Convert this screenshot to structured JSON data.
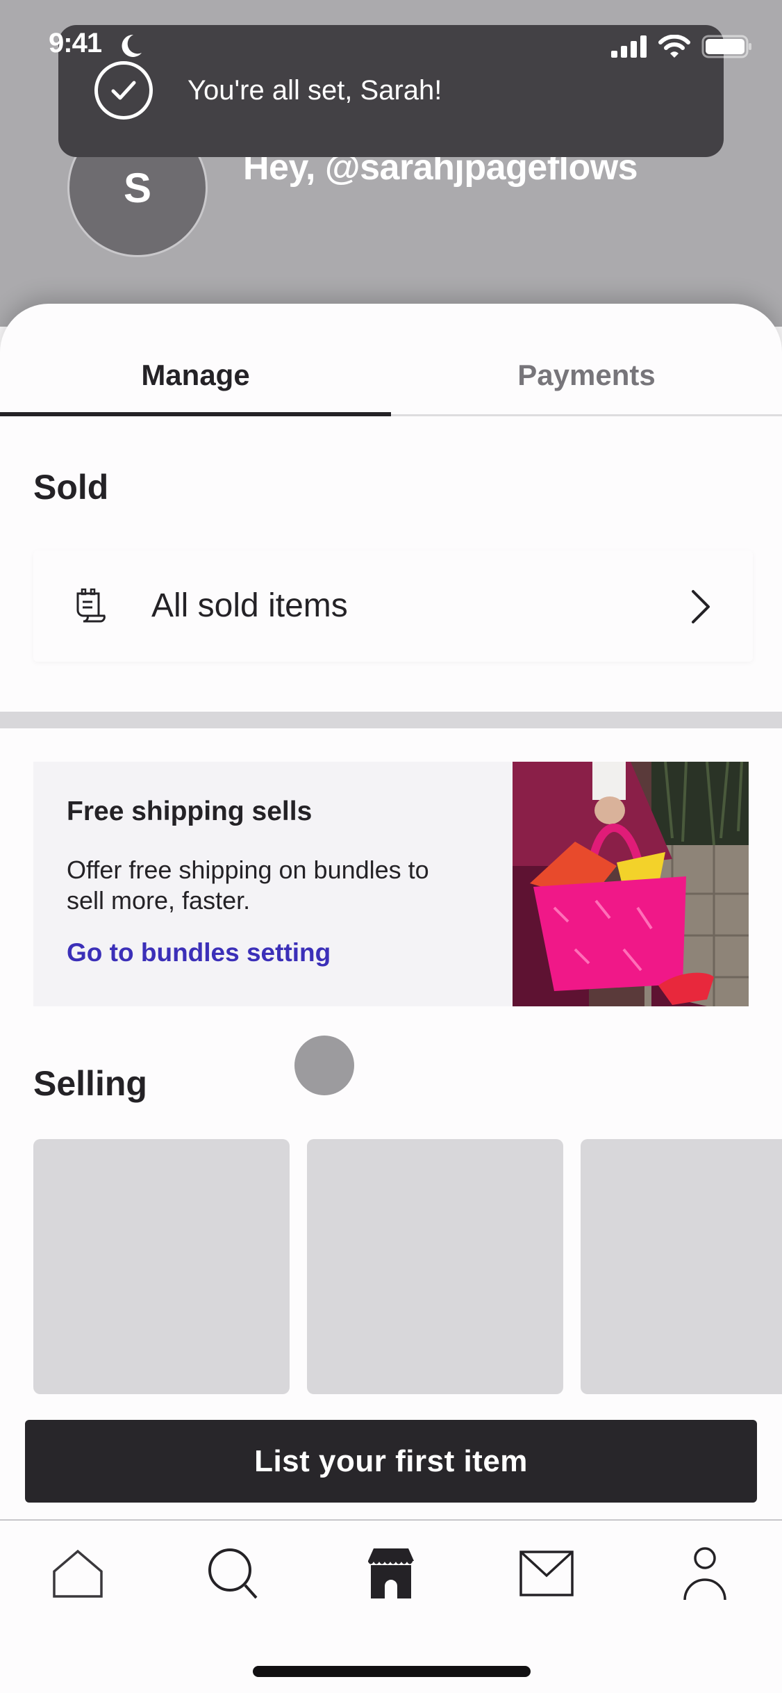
{
  "status_bar": {
    "time": "9:41",
    "icons": [
      "moon-icon",
      "cellular-signal-icon",
      "wifi-icon",
      "battery-icon"
    ]
  },
  "toast": {
    "icon": "check-circle-icon",
    "message": "You're all set, Sarah!"
  },
  "profile": {
    "avatar_initial": "S",
    "greeting": "Hey, @sarahjpageflows"
  },
  "tabs": [
    {
      "label": "Manage",
      "active": true
    },
    {
      "label": "Payments",
      "active": false
    }
  ],
  "sold": {
    "title": "Sold",
    "row": {
      "icon": "receipt-icon",
      "label": "All sold items",
      "chevron": "chevron-right-icon"
    }
  },
  "promo": {
    "title": "Free shipping sells",
    "body": "Offer free shipping on bundles to sell more, faster.",
    "link": "Go to bundles setting",
    "image": "Person holding a fuzzy pink tote bag",
    "link_color": "#3b2fb8"
  },
  "selling": {
    "title": "Selling",
    "placeholder_count": 3
  },
  "cta": {
    "label": "List your first item"
  },
  "bottom_nav": [
    {
      "name": "home",
      "icon": "home-icon",
      "active": false
    },
    {
      "name": "search",
      "icon": "search-icon",
      "active": false
    },
    {
      "name": "shop",
      "icon": "storefront-icon",
      "active": true
    },
    {
      "name": "inbox",
      "icon": "mail-icon",
      "active": false
    },
    {
      "name": "profile",
      "icon": "person-icon",
      "active": false
    }
  ],
  "colors": {
    "primary_text": "#242226",
    "inactive_tab": "#77757a",
    "button_bg": "#28262a",
    "skeleton": "#d8d7da",
    "toast_bg": "#434145"
  }
}
